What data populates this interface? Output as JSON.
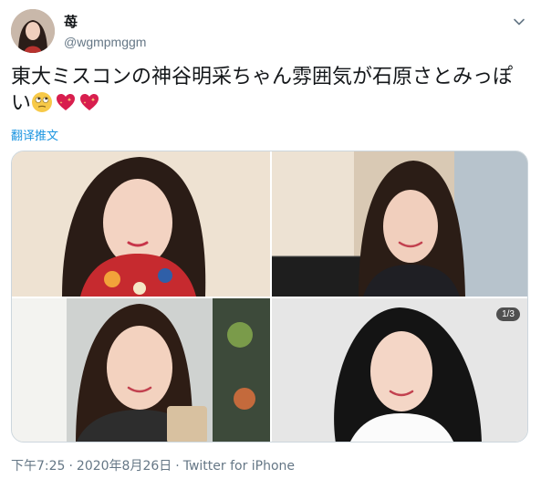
{
  "user": {
    "display_name": "苺",
    "handle": "@wgmpmggm"
  },
  "tweet": {
    "text": "東大ミスコンの神谷明采ちゃん雰囲気が石原さとみっぽい",
    "emojis": [
      "face-with-rolling-eyes",
      "sparkling-heart",
      "sparkling-heart"
    ]
  },
  "translate_label": "翻译推文",
  "media": {
    "count_badge": "1/3"
  },
  "meta": {
    "time": "下午7:25",
    "separator": "·",
    "date": "2020年8月26日",
    "source": "Twitter for iPhone"
  },
  "colors": {
    "link": "#1b95e0",
    "secondary_text": "#657786",
    "border": "#ccd6dd"
  }
}
